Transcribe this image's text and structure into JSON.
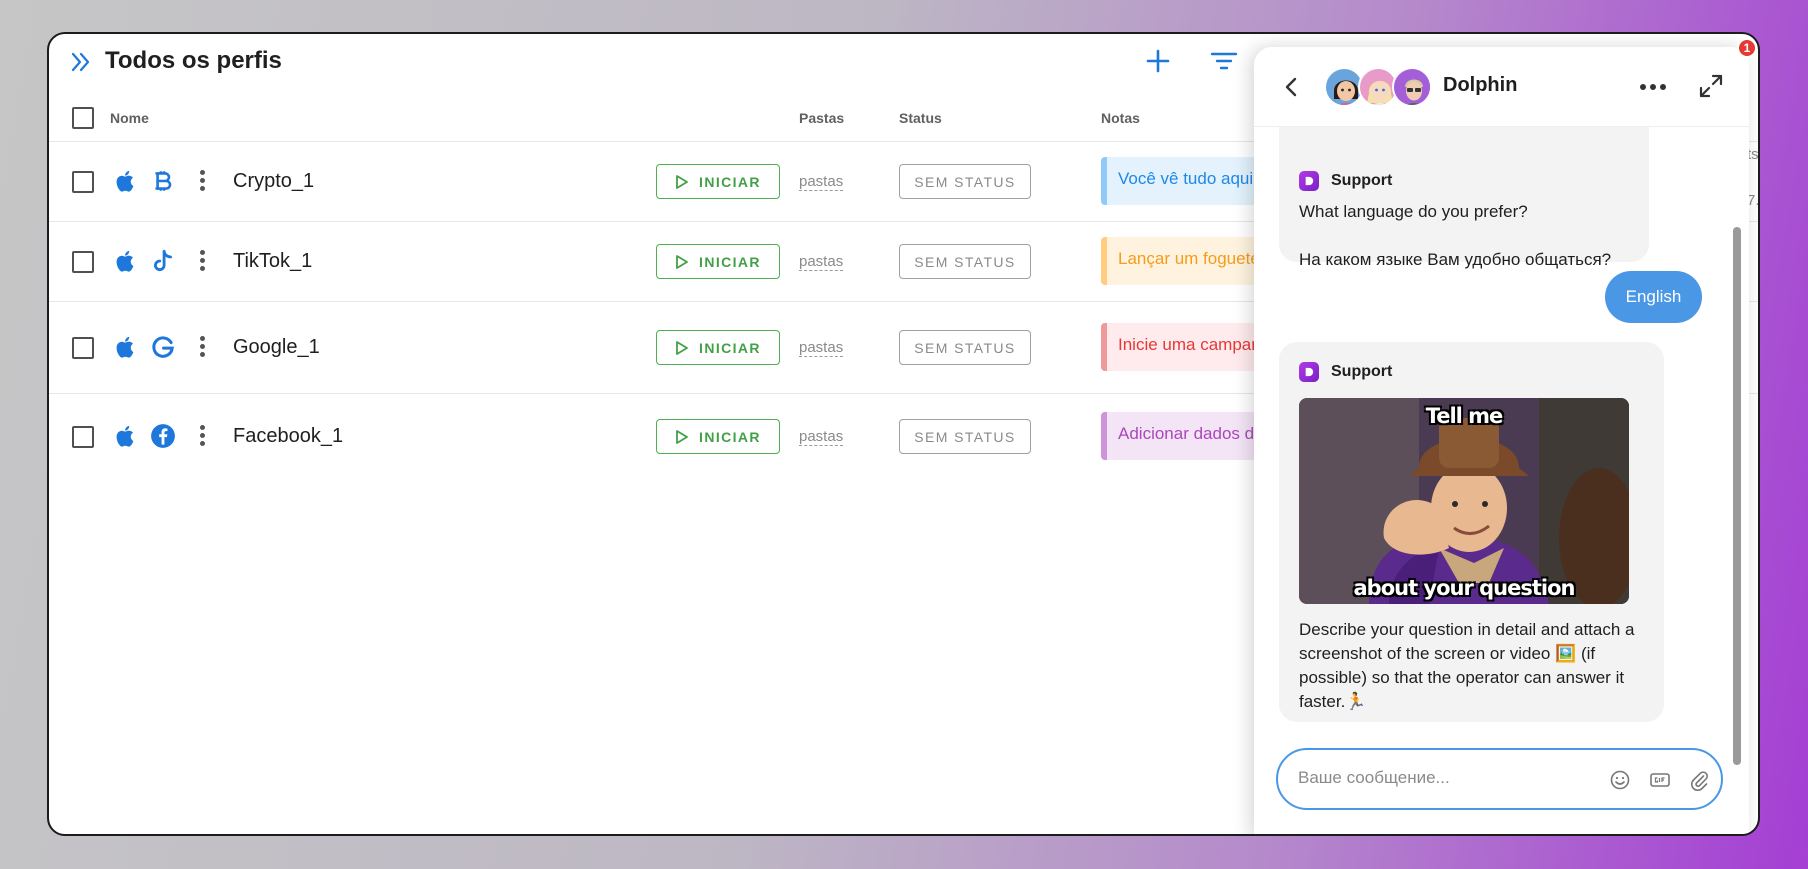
{
  "header": {
    "title": "Todos os perfis"
  },
  "columns": {
    "name": "Nome",
    "folders": "Pastas",
    "status": "Status",
    "notes": "Notas"
  },
  "profiles": [
    {
      "name": "Crypto_1",
      "service_icon": "bitcoin-icon",
      "start_label": "INICIAR",
      "folders": "pastas",
      "status": "SEM STATUS",
      "note": "Você vê tudo aqui",
      "note_color": "#1e88e5",
      "note_bg": "#e3f2fd",
      "note_border": "#90caf9"
    },
    {
      "name": "TikTok_1",
      "service_icon": "tiktok-icon",
      "start_label": "INICIAR",
      "folders": "pastas",
      "status": "SEM STATUS",
      "note": "Lançar um foguete",
      "note_color": "#f59c1a",
      "note_bg": "#fff3e0",
      "note_border": "#ffcc80"
    },
    {
      "name": "Google_1",
      "service_icon": "google-icon",
      "start_label": "INICIAR",
      "folders": "pastas",
      "status": "SEM STATUS",
      "note": "Inicie uma campanha",
      "note_color": "#e53935",
      "note_bg": "#ffebee",
      "note_border": "#ef9a9a"
    },
    {
      "name": "Facebook_1",
      "service_icon": "facebook-icon",
      "start_label": "INICIAR",
      "folders": "pastas",
      "status": "SEM STATUS",
      "note": "Adicionar dados de",
      "note_color": "#ab47bc",
      "note_bg": "#f3e5f5",
      "note_border": "#ce93d8"
    }
  ],
  "badge": {
    "count": "1"
  },
  "edge_text": {
    "top": "ts:",
    "second": "7."
  },
  "chat": {
    "title": "Dolphin",
    "messages": [
      {
        "sender": "Support",
        "lines": [
          "What language do you prefer?",
          "",
          "На каком языке Вам удобно общаться?"
        ]
      },
      {
        "sender": "user",
        "text": "English"
      },
      {
        "sender": "Support",
        "meme_top": "Tell me",
        "meme_bottom": "about your question",
        "text": "Describe your question in detail and attach a screenshot of the screen or video 🖼️ (if possible) so that the operator can answer it faster.🏃"
      }
    ],
    "composer_placeholder": "Ваше сообщение..."
  },
  "colors": {
    "accent_blue": "#1e78dc",
    "start_green": "#43a047",
    "user_bubble": "#4a97e6"
  }
}
